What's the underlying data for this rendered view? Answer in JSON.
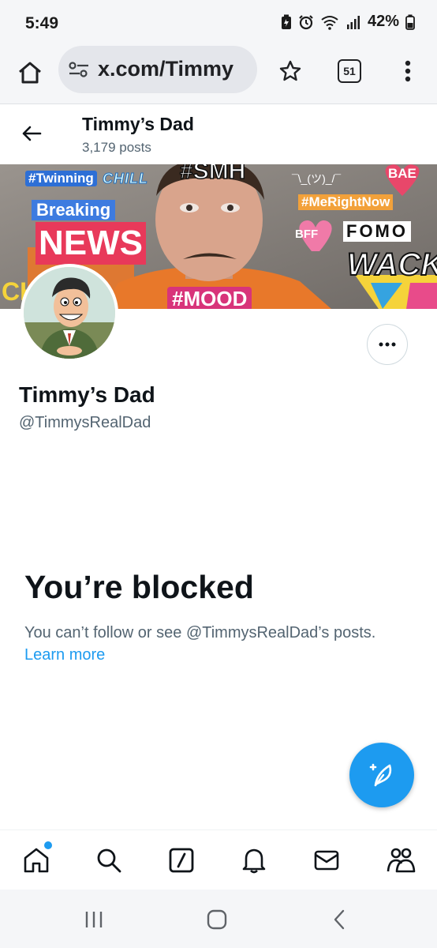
{
  "status_bar": {
    "time": "5:49",
    "battery": "42%",
    "icons": [
      "battery-saver-icon",
      "alarm-icon",
      "wifi-icon",
      "signal-icon",
      "battery-icon"
    ]
  },
  "browser": {
    "url": "x.com/Timmy",
    "tab_count": "51",
    "icons": [
      "home-icon",
      "site-settings-icon",
      "star-icon",
      "tabs-icon",
      "more-vertical-icon"
    ]
  },
  "header": {
    "name": "Timmy’s Dad",
    "posts": "3,179 posts"
  },
  "banner": {
    "stickers": [
      "#Twinning",
      "CHILL",
      "#SMH",
      "BAE",
      "Breaking",
      "NEWS",
      "#MeRightNow",
      "BFF",
      "FOMO",
      "WACK",
      "#MOOD",
      "CH",
      "¯\\_(ツ)_/¯"
    ]
  },
  "profile": {
    "name": "Timmy’s Dad",
    "handle": "@TimmysRealDad"
  },
  "blocked": {
    "title": "You’re blocked",
    "message": "You can’t follow or see @TimmysRealDad’s posts.",
    "link": "Learn more"
  },
  "colors": {
    "accent": "#1d9bf0",
    "secondary_text": "#536471",
    "primary_text": "#0f1419"
  },
  "bottom_nav": [
    "home-icon",
    "search-icon",
    "grok-icon",
    "notifications-icon",
    "messages-icon",
    "communities-icon"
  ],
  "android_nav": [
    "recents-icon",
    "home-icon",
    "back-icon"
  ]
}
